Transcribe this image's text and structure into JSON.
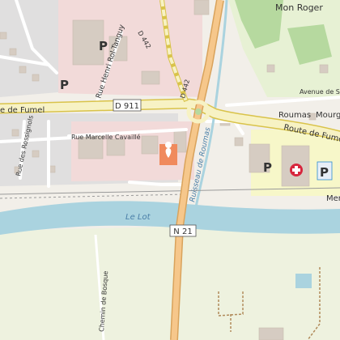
{
  "map": {
    "place_labels": {
      "mon_roger": "Mon Roger",
      "roumas": "Roumas",
      "mourg": "Mourg",
      "mer": "Mer"
    },
    "road_labels": {
      "route_de_fumel_west": "e de Fumel",
      "route_de_fumel_east": "Route de Fumel",
      "rue_henri_rol_tanguy": "Rue Henri Rol-Tanguy",
      "rue_marcelle_cavaille": "Rue Marcelle Cavaillé",
      "rue_des_rossignols": "Rue des Rossignols",
      "avenue_de_sc": "Avenue de Sc",
      "chemin_de_bosque": "Chemin de Bosque",
      "d442_north": "D 442",
      "d442_junction": "D 442"
    },
    "road_shields": {
      "d911": "D 911",
      "n21": "N 21"
    },
    "water_labels": {
      "le_lot": "Le Lot",
      "ruisseau_de_roumas": "Ruisseau de Roumas"
    },
    "parking_symbol": "P",
    "colors": {
      "background": "#f2efe9",
      "river": "#aad3df",
      "main_road": "#f6c78b",
      "main_road_casing": "#d9a35c",
      "secondary_road": "#f7f2c4",
      "residential": "#e0dfdf",
      "commercial": "#f2dad9",
      "hospital": "#f7f7c9",
      "forest": "#b6d99f",
      "grass": "#e7f1d4",
      "parking": "#2b8bd1",
      "marker": "#f08a5d"
    },
    "icons": [
      "parking-icon",
      "hospital-icon",
      "location-marker-icon"
    ]
  }
}
